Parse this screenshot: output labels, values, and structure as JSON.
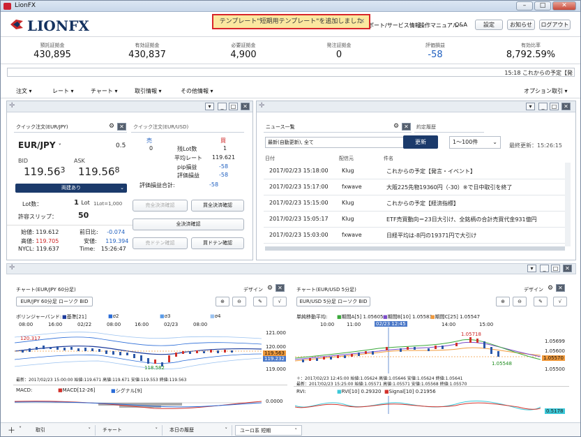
{
  "window": {
    "title": "LionFX",
    "min": "–",
    "max": "□",
    "close": "✕"
  },
  "header": {
    "logo": "LIONFX",
    "toast": {
      "text": "テンプレート\"短期用テンプレート\"を追加しました",
      "close": "✕"
    },
    "links": [
      "ポート/サービス情報",
      "操作マニュアル",
      "Q&A"
    ],
    "buttons": [
      "設定",
      "お知らせ",
      "ログアウト"
    ]
  },
  "stats": [
    {
      "label": "預託証拠金",
      "value": "430,895"
    },
    {
      "label": "有効証拠金",
      "value": "430,837"
    },
    {
      "label": "必要証拠金",
      "value": "4,900"
    },
    {
      "label": "発注証拠金",
      "value": "0"
    },
    {
      "label": "評価損益",
      "value": "-58"
    },
    {
      "label": "有効比率",
      "value": "8,792.59%"
    }
  ],
  "ticker": "15:18  これからの予定【発",
  "menu": {
    "items": [
      "注文",
      "レート",
      "チャート",
      "取引情報",
      "その他情報"
    ],
    "right": "オプション取引"
  },
  "quick_jpy": {
    "title": "クイック注文(EUR/JPY)",
    "pair": "EUR/JPY",
    "lot_setting": "0.5",
    "bid_label": "BID",
    "ask_label": "ASK",
    "bid_main": "119.56",
    "bid_pip": "3",
    "ask_main": "119.56",
    "ask_pip": "8",
    "mode": "両建あり",
    "lot_label": "Lot数：",
    "lot_value": "1",
    "lot_unit": "Lot",
    "lot_note": "1Lot=1,000",
    "slip_label": "許容スリップ：",
    "slip_value": "50",
    "open_label": "始値:",
    "open_value": "119.612",
    "high_label": "高値:",
    "high_value": "119.705",
    "nycl_label": "NYCL:",
    "nycl_value": "119.637",
    "prev_label": "前日比:",
    "prev_value": "-0.074",
    "low_label": "安値:",
    "low_value": "119.394",
    "time_label": "Time:",
    "time_value": "15:26:47"
  },
  "quick_usd": {
    "title": "クイック注文(EUR/USD)",
    "sell": "売",
    "buy": "買",
    "sell_lots": "0",
    "buy_lots": "1",
    "rem_lots": "残Lot数",
    "avg_rate_label": "平均レート",
    "avg_rate": "119.621",
    "pip_label": "pip損益",
    "pip_value": "-58",
    "eval_label": "評価損益",
    "eval_value": "-58",
    "total_label": "評価損益合計:",
    "total_value": "-58",
    "btn_sell_all": "売全決済確認",
    "btn_buy_all": "買全決済確認",
    "btn_all": "全決済確認",
    "btn_sell_doten": "売ドテン確認",
    "btn_buy_doten": "買ドテン確認"
  },
  "news": {
    "title": "ニュース一覧",
    "tab2": "約定履歴",
    "filter": "最新(自動更新), 全て",
    "refresh": "更新",
    "range": "1～100件",
    "updated": "最終更新：15:26:15",
    "cols": [
      "日付",
      "配信元",
      "件名"
    ],
    "rows": [
      {
        "date": "2017/02/23 15:18:00",
        "src": "Klug",
        "subject": "これからの予定【発言・イベント】"
      },
      {
        "date": "2017/02/23 15:17:00",
        "src": "fxwave",
        "subject": "大阪225先物19360円（-30）※で日中取引を終了"
      },
      {
        "date": "2017/02/23 15:15:00",
        "src": "Klug",
        "subject": "これからの予定【経済指標】"
      },
      {
        "date": "2017/02/23 15:05:17",
        "src": "Klug",
        "subject": "ETF売買動向＝23日大引け、全銘柄の合計売買代金931億円"
      },
      {
        "date": "2017/02/23 15:03:00",
        "src": "fxwave",
        "subject": "日経平均は-8円の19371円で大引け"
      }
    ]
  },
  "chart1": {
    "title": "チャート(EUR/JPY 60分足)",
    "design": "デザイン",
    "selector": "EUR/JPY 60分足 ローソク BID",
    "indicator": "ボリンジャーバンド:",
    "legend": [
      "基準[21]",
      "σ2",
      "σ3",
      "σ4"
    ],
    "times": [
      "08:00",
      "16:00",
      "02/22",
      "08:00",
      "16:00",
      "02/23",
      "08:00"
    ],
    "yticks": [
      "121.000",
      "120.000",
      "119.000"
    ],
    "price_hi": "120.317",
    "price_lo": "118.582",
    "price_tag1": "119.563",
    "price_tag2": "119.232",
    "ohlc": "最新：2017/02/23 15:00:00  始値:119.671 高値:119.671 安値:119.553 終値:119.563",
    "sub": "MACD:",
    "sub_legend": [
      "MACD[12-26]",
      "シグナル[9]"
    ],
    "sub_tick": "0.0000"
  },
  "chart2": {
    "title": "チャート(EUR/USD 5分足)",
    "design": "デザイン",
    "selector": "EUR/USD 5分足 ローソク BID",
    "indicator": "単純移動平均:",
    "legend": [
      "期間A[5] 1.05605",
      "期間B[10] 1.05583",
      "期間C[25] 1.05547"
    ],
    "times": [
      "10:00",
      "11:00",
      "02/23 12:45",
      "14:00",
      "15:00"
    ],
    "yticks": [
      "1.05699",
      "1.05600",
      "1.05500"
    ],
    "price_hi": "1.05718",
    "price_lo": "1.05548",
    "price_tag": "1.05570",
    "ohlc": "＋：2017/02/23 12:45:00  始値:1.05624 高値:1.05646 安値:1.05624 終値:1.05641",
    "ohlc2": "最新：2017/02/23 15:25:00  始値:1.05571 高値:1.05571 安値:1.05568 終値:1.05570",
    "sub": "RVI:",
    "sub_legend": [
      "RVI[10] 0.29320",
      "Signal[10] 0.21956"
    ],
    "sub_tick": "0.5178"
  },
  "statusbar": {
    "tabs": [
      "取引",
      "チャート",
      "本日の履歴",
      "ユーロ系 短期"
    ]
  },
  "colors": {
    "navy": "#1b3a6b",
    "bid_red": "#cc2222",
    "blue": "#2060c0",
    "toast_bg": "#fbe8a0",
    "toast_border": "#d8262a"
  }
}
